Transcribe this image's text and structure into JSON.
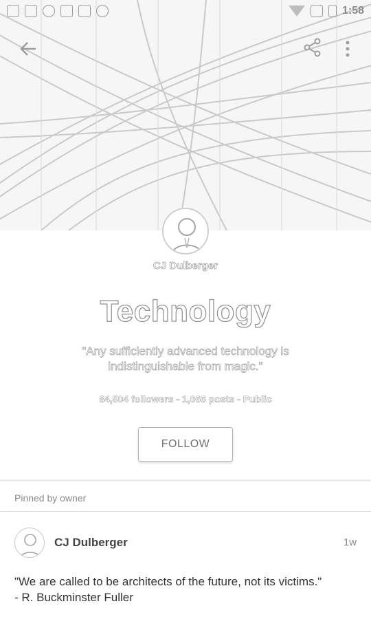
{
  "status_bar": {
    "time": "1:58",
    "icons": [
      "notification-icon",
      "message-icon",
      "info-icon",
      "lock-icon",
      "app-icon",
      "android-icon",
      "wifi-icon",
      "no-sim-icon",
      "battery-icon"
    ]
  },
  "header": {
    "back_icon": "arrow-left-icon",
    "share_icon": "share-icon",
    "more_icon": "more-vertical-icon"
  },
  "community": {
    "owner_name": "CJ Dulberger",
    "title": "Technology",
    "tagline": "\"Any sufficiently advanced technology is indistinguishable from magic.\"",
    "stats": "84,504 followers - 1,066 posts - Public",
    "follow_label": "FOLLOW"
  },
  "pinned": {
    "label": "Pinned by owner",
    "post": {
      "author": "CJ Dulberger",
      "time": "1w",
      "line1": "\"We are called to be architects of the future, not its victims.\"",
      "line2": "- R. Buckminster Fuller"
    }
  }
}
